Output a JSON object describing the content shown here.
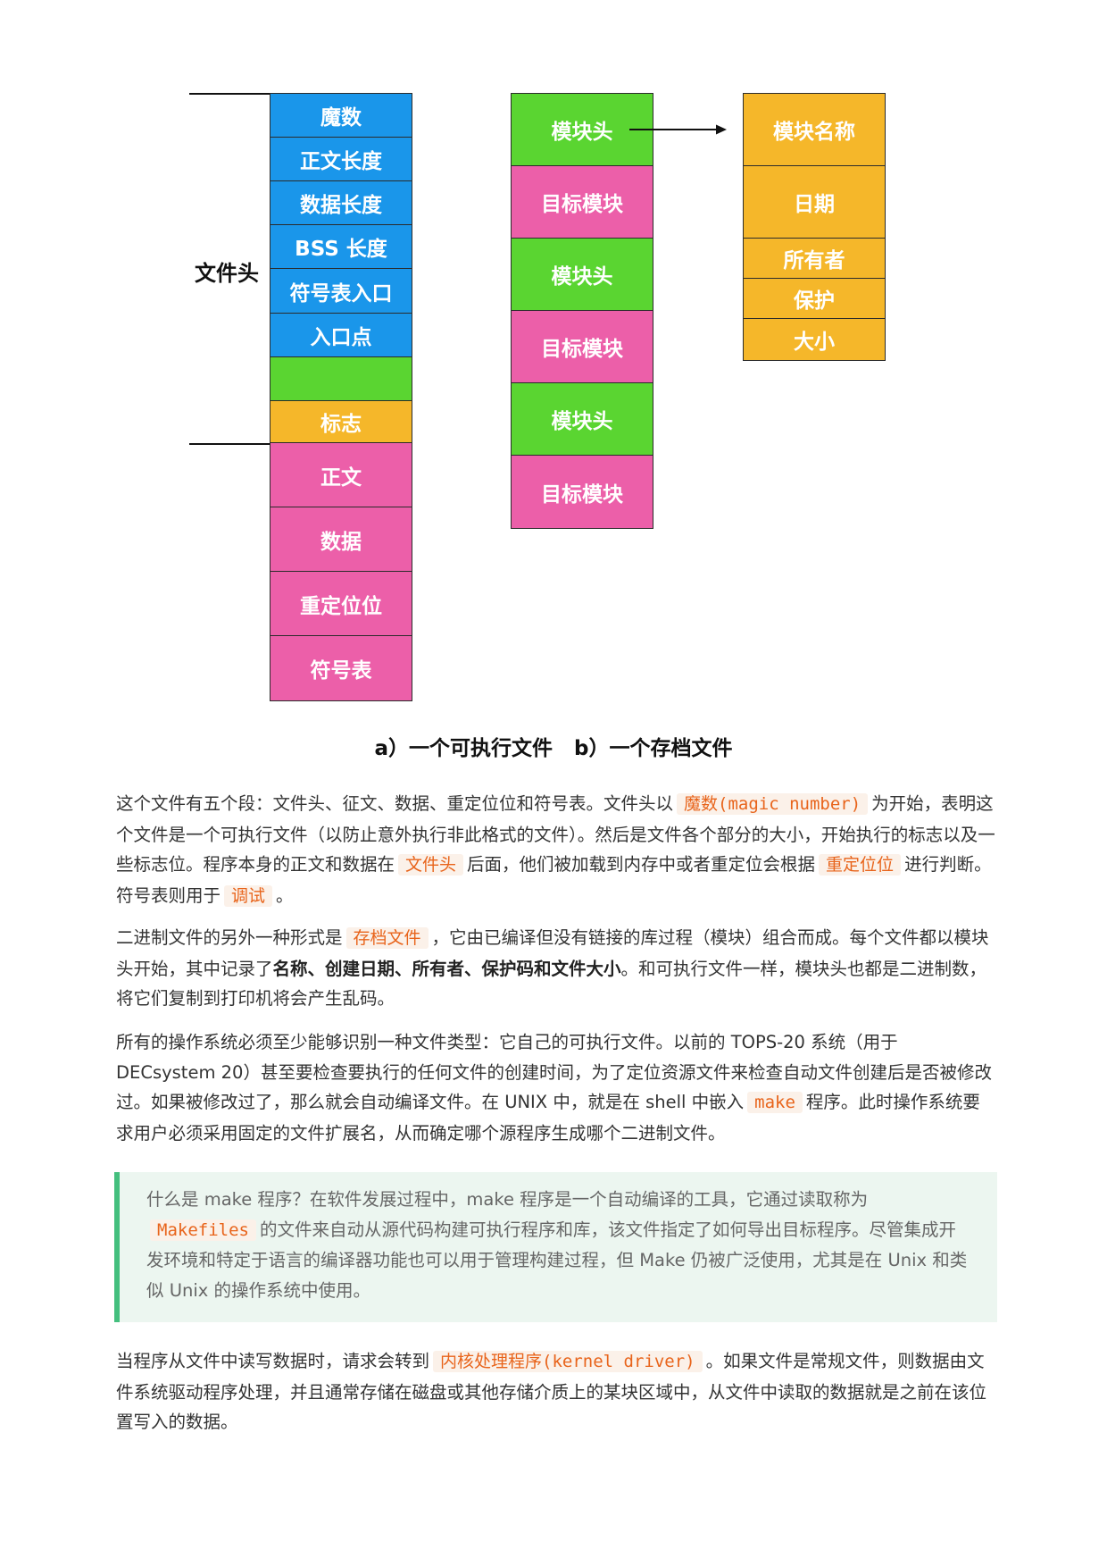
{
  "figure": {
    "exe_header_label": "文件头",
    "exe_cells": [
      "魔数",
      "正文长度",
      "数据长度",
      "BSS 长度",
      "符号表入口",
      "入口点",
      "",
      "标志",
      "正文",
      "数据",
      "重定位位",
      "符号表"
    ],
    "archive_cells": [
      "模块头",
      "目标模块",
      "模块头",
      "目标模块",
      "模块头",
      "目标模块"
    ],
    "module_header_cells": [
      "模块名称",
      "日期",
      "所有者",
      "保护",
      "大小"
    ],
    "caption": "a）一个可执行文件   b）一个存档文件",
    "colors": {
      "blue": "#1a96ea",
      "green": "#5ad531",
      "orange": "#f5b72a",
      "pink": "#ec5fa9"
    }
  },
  "p1": {
    "t1": "这个文件有五个段：文件头、征文、数据、重定位位和符号表。文件头以",
    "c1": "魔数(magic number)",
    "t2": "为开始，表明这个文件是一个可执行文件（以防止意外执行非此格式的文件）。然后是文件各个部分的大小，开始执行的标志以及一些标志位。程序本身的正文和数据在",
    "c2": "文件头",
    "t3": "后面，他们被加载到内存中或者重定位会根据",
    "c3": "重定位位",
    "t4": "进行判断。符号表则用于",
    "c4": "调试",
    "t5": "。"
  },
  "p2": {
    "t1": "二进制文件的另外一种形式是",
    "c1": "存档文件",
    "t2": "，它由已编译但没有链接的库过程（模块）组合而成。每个文件都以模块头开始，其中记录了",
    "b1": "名称、创建日期、所有者、保护码和文件大小",
    "t3": "。和可执行文件一样，模块头也都是二进制数，将它们复制到打印机将会产生乱码。"
  },
  "p3": {
    "t1": "所有的操作系统必须至少能够识别一种文件类型：它自己的可执行文件。以前的 TOPS-20 系统（用于 DECsystem 20）甚至要检查要执行的任何文件的创建时间，为了定位资源文件来检查自动文件创建后是否被修改过。如果被修改过了，那么就会自动编译文件。在 UNIX 中，就是在 shell 中嵌入",
    "c1": "make",
    "t2": "程序。此时操作系统要求用户必须采用固定的文件扩展名，从而确定哪个源程序生成哪个二进制文件。"
  },
  "note": {
    "t1": "什么是 make 程序？在软件发展过程中，make 程序是一个自动编译的工具，它通过读取称为",
    "c1": "Makefiles",
    "t2": "的文件来自动从源代码构建可执行程序和库，该文件指定了如何导出目标程序。尽管集成开发环境和特定于语言的编译器功能也可以用于管理构建过程，但 Make 仍被广泛使用，尤其是在 Unix 和类似 Unix 的操作系统中使用。"
  },
  "p4": {
    "t1": "当程序从文件中读写数据时，请求会转到",
    "c1": "内核处理程序(kernel driver)",
    "t2": "。如果文件是常规文件，则数据由文件系统驱动程序处理，并且通常存储在磁盘或其他存储介质上的某块区域中，从文件中读取的数据就是之前在该位置写入的数据。"
  }
}
